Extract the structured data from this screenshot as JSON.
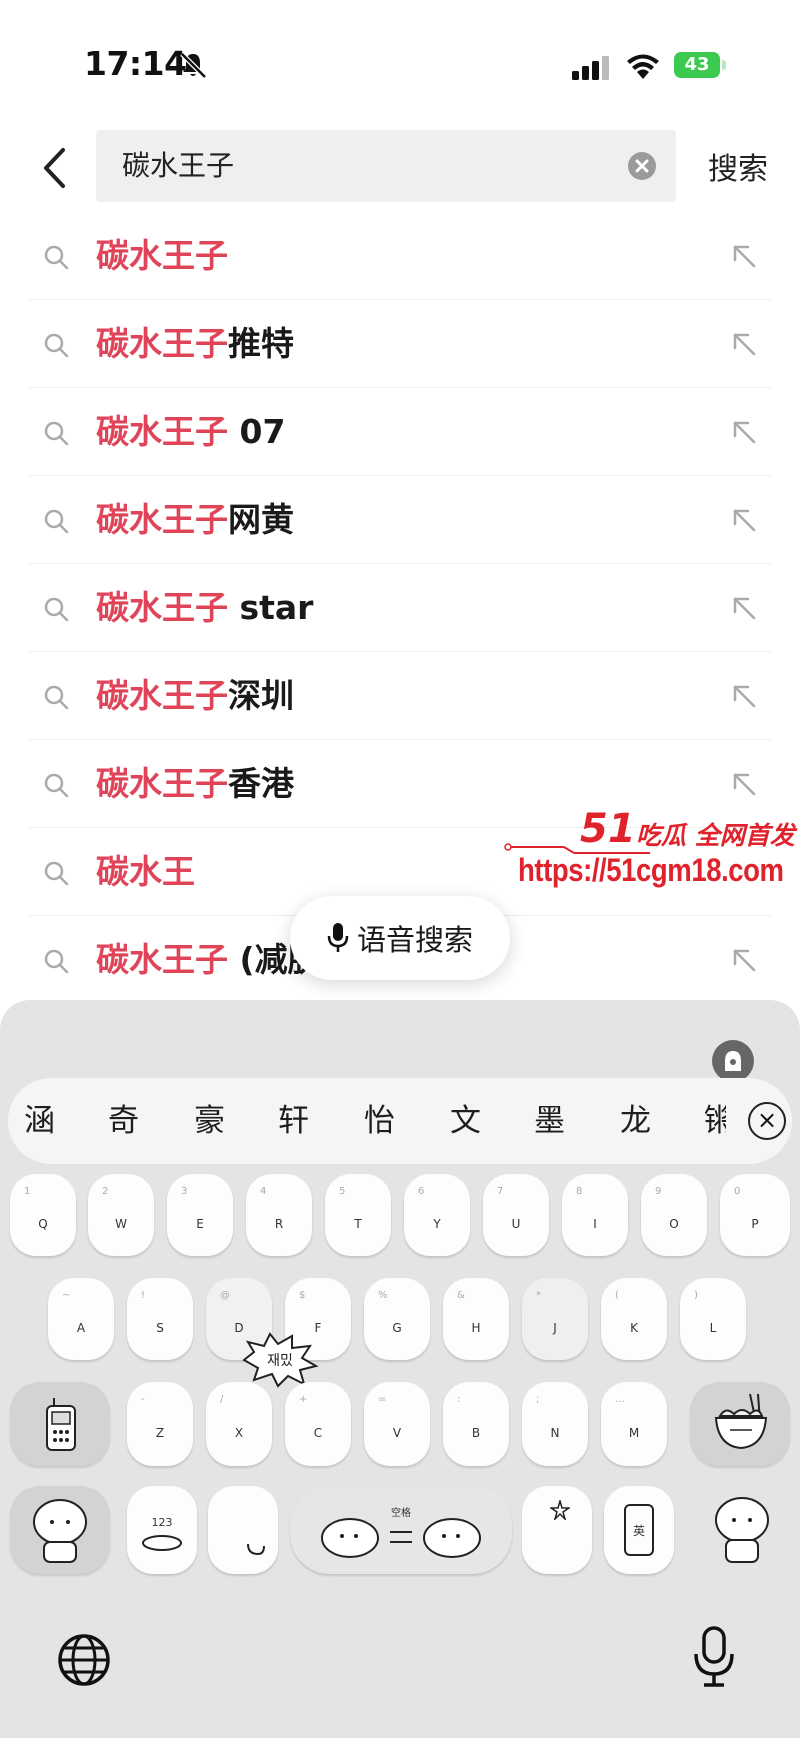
{
  "status_bar": {
    "time": "17:14",
    "battery": "43",
    "icons": [
      "bell-slash-icon",
      "signal-icon",
      "wifi-icon",
      "battery-icon"
    ]
  },
  "search": {
    "query": "碳水王子",
    "button_label": "搜索",
    "icons": [
      "back-chevron-icon",
      "clear-icon"
    ]
  },
  "suggestions": [
    {
      "highlight": "碳水王子",
      "rest": ""
    },
    {
      "highlight": "碳水王子",
      "rest": "推特"
    },
    {
      "highlight": "碳水王子",
      "rest": " 07"
    },
    {
      "highlight": "碳水王子",
      "rest": "网黄"
    },
    {
      "highlight": "碳水王子",
      "rest": " star"
    },
    {
      "highlight": "碳水王子",
      "rest": "深圳"
    },
    {
      "highlight": "碳水王子",
      "rest": "香港"
    },
    {
      "highlight": "碳水王",
      "rest": ""
    },
    {
      "highlight": "碳水王子",
      "rest": " (减肽"
    }
  ],
  "voice_search": {
    "label": "语音搜索",
    "icon": "mic-icon"
  },
  "watermark": {
    "number": "51",
    "tagline": "吃瓜 全网首发",
    "url": "https://51cgm18.com"
  },
  "keyboard": {
    "candidates": [
      "涵",
      "奇",
      "豪",
      "轩",
      "怡",
      "文",
      "墨",
      "龙",
      "锵"
    ],
    "row1": [
      {
        "letter": "Q",
        "sub": "1"
      },
      {
        "letter": "W",
        "sub": "2"
      },
      {
        "letter": "E",
        "sub": "3"
      },
      {
        "letter": "R",
        "sub": "4"
      },
      {
        "letter": "T",
        "sub": "5"
      },
      {
        "letter": "Y",
        "sub": "6"
      },
      {
        "letter": "U",
        "sub": "7"
      },
      {
        "letter": "I",
        "sub": "8"
      },
      {
        "letter": "O",
        "sub": "9"
      },
      {
        "letter": "P",
        "sub": "0"
      }
    ],
    "row2": [
      {
        "letter": "A",
        "sub": "~"
      },
      {
        "letter": "S",
        "sub": "!"
      },
      {
        "letter": "D",
        "sub": "@"
      },
      {
        "letter": "F",
        "sub": "$"
      },
      {
        "letter": "G",
        "sub": "%"
      },
      {
        "letter": "H",
        "sub": "&"
      },
      {
        "letter": "J",
        "sub": "*"
      },
      {
        "letter": "K",
        "sub": "("
      },
      {
        "letter": "L",
        "sub": ")"
      }
    ],
    "row3": [
      {
        "letter": "Z",
        "sub": "-"
      },
      {
        "letter": "X",
        "sub": "/"
      },
      {
        "letter": "C",
        "sub": "+"
      },
      {
        "letter": "V",
        "sub": "="
      },
      {
        "letter": "B",
        "sub": ":"
      },
      {
        "letter": "N",
        "sub": ";"
      },
      {
        "letter": "M",
        "sub": "…"
      }
    ],
    "num_key": "123",
    "space_key": "空格",
    "lang_key": "英",
    "sticker": "재밌",
    "icons": [
      "phone-sticker-icon",
      "noodle-bowl-icon",
      "globe-icon",
      "mic-icon",
      "emoji-bear-icon"
    ]
  }
}
